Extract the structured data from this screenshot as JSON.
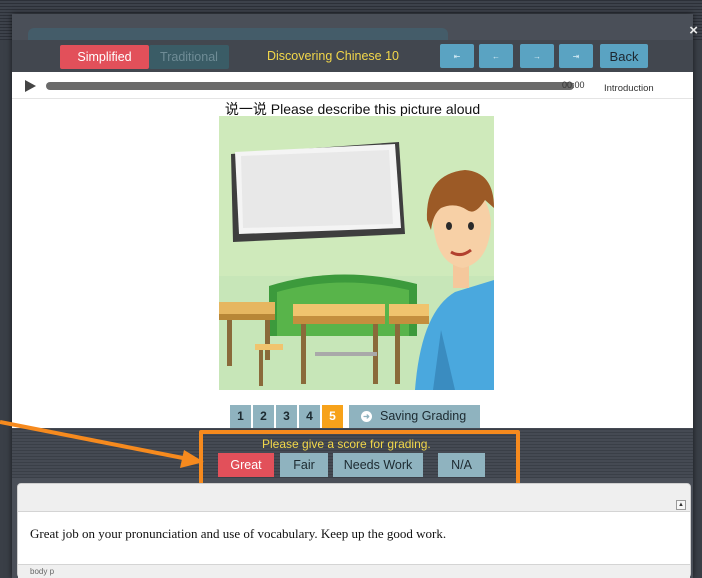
{
  "window": {
    "close_glyph": "×"
  },
  "toolbar": {
    "simplified_label": "Simplified",
    "traditional_label": "Traditional",
    "title": "Discovering Chinese 10",
    "nav_icons": [
      "step-back-icon",
      "arrow-left-icon",
      "arrow-right-icon",
      "step-forward-icon"
    ],
    "nav_glyphs": [
      "⇤",
      "←",
      "→",
      "⇥"
    ],
    "back_label": "Back"
  },
  "audio": {
    "time": "00:00",
    "section": "Introduction"
  },
  "prompt": "说一说 Please describe this picture aloud",
  "pager": {
    "pages": [
      "1",
      "2",
      "3",
      "4",
      "5"
    ],
    "active_page": "5",
    "saving_label": "Saving Grading"
  },
  "grading": {
    "prompt": "Please give a score for grading.",
    "options": [
      "Great",
      "Fair",
      "Needs Work",
      "N/A"
    ],
    "selected": "Great"
  },
  "editor": {
    "text": "Great job on your pronunciation and use of vocabulary. Keep up the good work.",
    "status_path": "body  p"
  },
  "colors": {
    "accent_red": "#e2505a",
    "title_yellow": "#f2d74a",
    "nav_blue": "#5aa3c2",
    "pager_blue": "#8fb3bf",
    "active_orange": "#f7a21a",
    "highlight_orange": "#f68a1e"
  }
}
